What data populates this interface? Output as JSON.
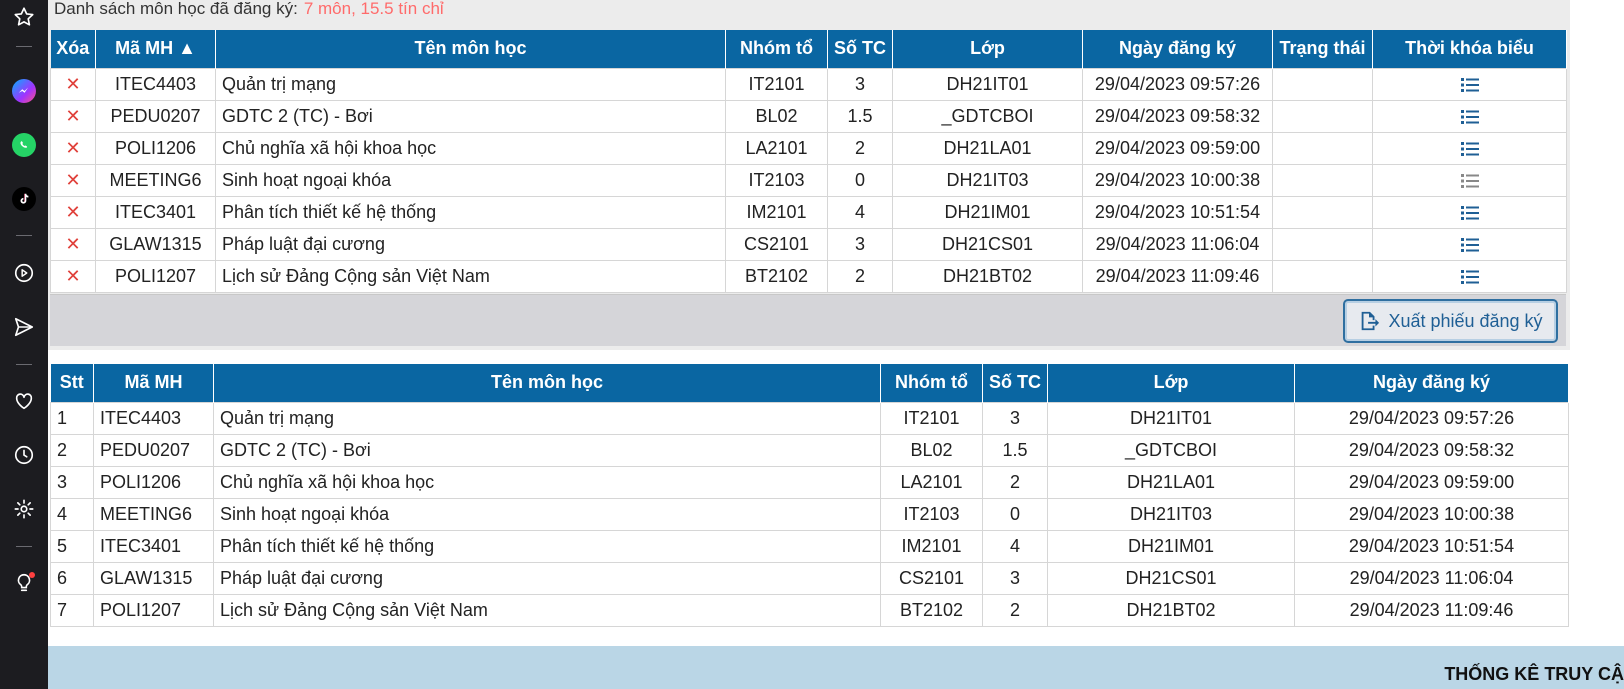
{
  "sidebar": {
    "icons": [
      "star-icon",
      "messenger-icon",
      "whatsapp-icon",
      "tiktok-icon",
      "play-icon",
      "send-icon",
      "heart-icon",
      "clock-icon",
      "gear-icon",
      "lightbulb-icon"
    ]
  },
  "summary": {
    "label": "Danh sách môn học đã đăng ký:",
    "count": "7 môn, 15.5 tín chỉ"
  },
  "registered_table": {
    "headers": [
      "Xóa",
      "Mã MH ▲",
      "Tên môn học",
      "Nhóm tổ",
      "Số TC",
      "Lớp",
      "Ngày đăng ký",
      "Trạng thái",
      "Thời khóa biểu"
    ],
    "rows": [
      {
        "code": "ITEC4403",
        "name": "Quản trị mạng",
        "group": "IT2101",
        "credits": "3",
        "class": "DH21IT01",
        "date": "29/04/2023 09:57:26",
        "status": ""
      },
      {
        "code": "PEDU0207",
        "name": "GDTC 2 (TC) - Bơi",
        "group": "BL02",
        "credits": "1.5",
        "class": "_GDTCBOI",
        "date": "29/04/2023 09:58:32",
        "status": ""
      },
      {
        "code": "POLI1206",
        "name": "Chủ nghĩa xã hội khoa học",
        "group": "LA2101",
        "credits": "2",
        "class": "DH21LA01",
        "date": "29/04/2023 09:59:00",
        "status": ""
      },
      {
        "code": "MEETING6",
        "name": "Sinh hoạt ngoại khóa",
        "group": "IT2103",
        "credits": "0",
        "class": "DH21IT03",
        "date": "29/04/2023 10:00:38",
        "status": ""
      },
      {
        "code": "ITEC3401",
        "name": "Phân tích thiết kế hệ thống",
        "group": "IM2101",
        "credits": "4",
        "class": "DH21IM01",
        "date": "29/04/2023 10:51:54",
        "status": ""
      },
      {
        "code": "GLAW1315",
        "name": "Pháp luật đại cương",
        "group": "CS2101",
        "credits": "3",
        "class": "DH21CS01",
        "date": "29/04/2023 11:06:04",
        "status": ""
      },
      {
        "code": "POLI1207",
        "name": "Lịch sử Đảng Cộng sản Việt Nam",
        "group": "BT2102",
        "credits": "2",
        "class": "DH21BT02",
        "date": "29/04/2023 11:09:46",
        "status": ""
      }
    ]
  },
  "export_button": {
    "label": "Xuất phiếu đăng ký"
  },
  "summary_table": {
    "headers": [
      "Stt",
      "Mã MH",
      "Tên môn học",
      "Nhóm tổ",
      "Số TC",
      "Lớp",
      "Ngày đăng ký"
    ],
    "rows": [
      {
        "stt": "1",
        "code": "ITEC4403",
        "name": "Quản trị mạng",
        "group": "IT2101",
        "credits": "3",
        "class": "DH21IT01",
        "date": "29/04/2023 09:57:26"
      },
      {
        "stt": "2",
        "code": "PEDU0207",
        "name": "GDTC 2 (TC) - Bơi",
        "group": "BL02",
        "credits": "1.5",
        "class": "_GDTCBOI",
        "date": "29/04/2023 09:58:32"
      },
      {
        "stt": "3",
        "code": "POLI1206",
        "name": "Chủ nghĩa xã hội khoa học",
        "group": "LA2101",
        "credits": "2",
        "class": "DH21LA01",
        "date": "29/04/2023 09:59:00"
      },
      {
        "stt": "4",
        "code": "MEETING6",
        "name": "Sinh hoạt ngoại khóa",
        "group": "IT2103",
        "credits": "0",
        "class": "DH21IT03",
        "date": "29/04/2023 10:00:38"
      },
      {
        "stt": "5",
        "code": "ITEC3401",
        "name": "Phân tích thiết kế hệ thống",
        "group": "IM2101",
        "credits": "4",
        "class": "DH21IM01",
        "date": "29/04/2023 10:51:54"
      },
      {
        "stt": "6",
        "code": "GLAW1315",
        "name": "Pháp luật đại cương",
        "group": "CS2101",
        "credits": "3",
        "class": "DH21CS01",
        "date": "29/04/2023 11:06:04"
      },
      {
        "stt": "7",
        "code": "POLI1207",
        "name": "Lịch sử Đảng Cộng sản Việt Nam",
        "group": "BT2102",
        "credits": "2",
        "class": "DH21BT02",
        "date": "29/04/2023 11:09:46"
      }
    ]
  },
  "footer": {
    "title": "THỐNG KÊ TRUY CẬ"
  },
  "colors": {
    "header_blue": "#0a66a2",
    "delete_red": "#e0403a",
    "summary_red": "#ff6b6b",
    "footer_blue": "#bad6e6"
  }
}
